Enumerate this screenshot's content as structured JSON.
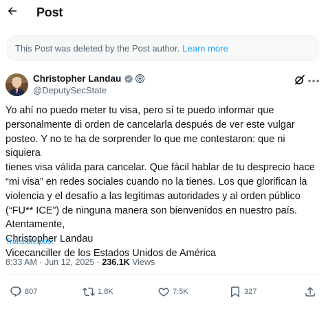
{
  "header": {
    "title": "Post"
  },
  "notice": {
    "text": "This Post was deleted by the Post author.",
    "link": "Learn more"
  },
  "author": {
    "name": "Christopher Landau",
    "handle": "@DeputySecState"
  },
  "post": {
    "body": "Yo ahí no puedo meter tu visa, pero sí te puedo informar que\npersonalmente di orden de cancelarla después de ver este vulgar\nposteo. Y no te ha de sorprender lo que me contestaron: que ni siquiera\ntienes visa válida para cancelar. Que fácil hablar de tu desprecio hace\n“mi visa” en redes sociales cuando no la tienes. Los que glorifican la\nviolencia y el desafío a las legítimas autoridades y al orden público\n(“FU** ICE”) de ninguna manera son bienvenidos en nuestro país.\nAtentamente,\nChristopher Landau\nVicecanciller de los Estados Unidos de América",
    "translate": "Translate post",
    "time": "8:33 AM · Jun 12, 2025 · ",
    "views": "236.1K",
    "views_label": " Views"
  },
  "actions": {
    "replies": "807",
    "reposts": "1.8K",
    "likes": "7.5K",
    "bookmarks": "327"
  },
  "colors": {
    "accent": "#1d9bf0",
    "secondary_text": "#536471",
    "notice_bg": "#f7f9f9"
  }
}
